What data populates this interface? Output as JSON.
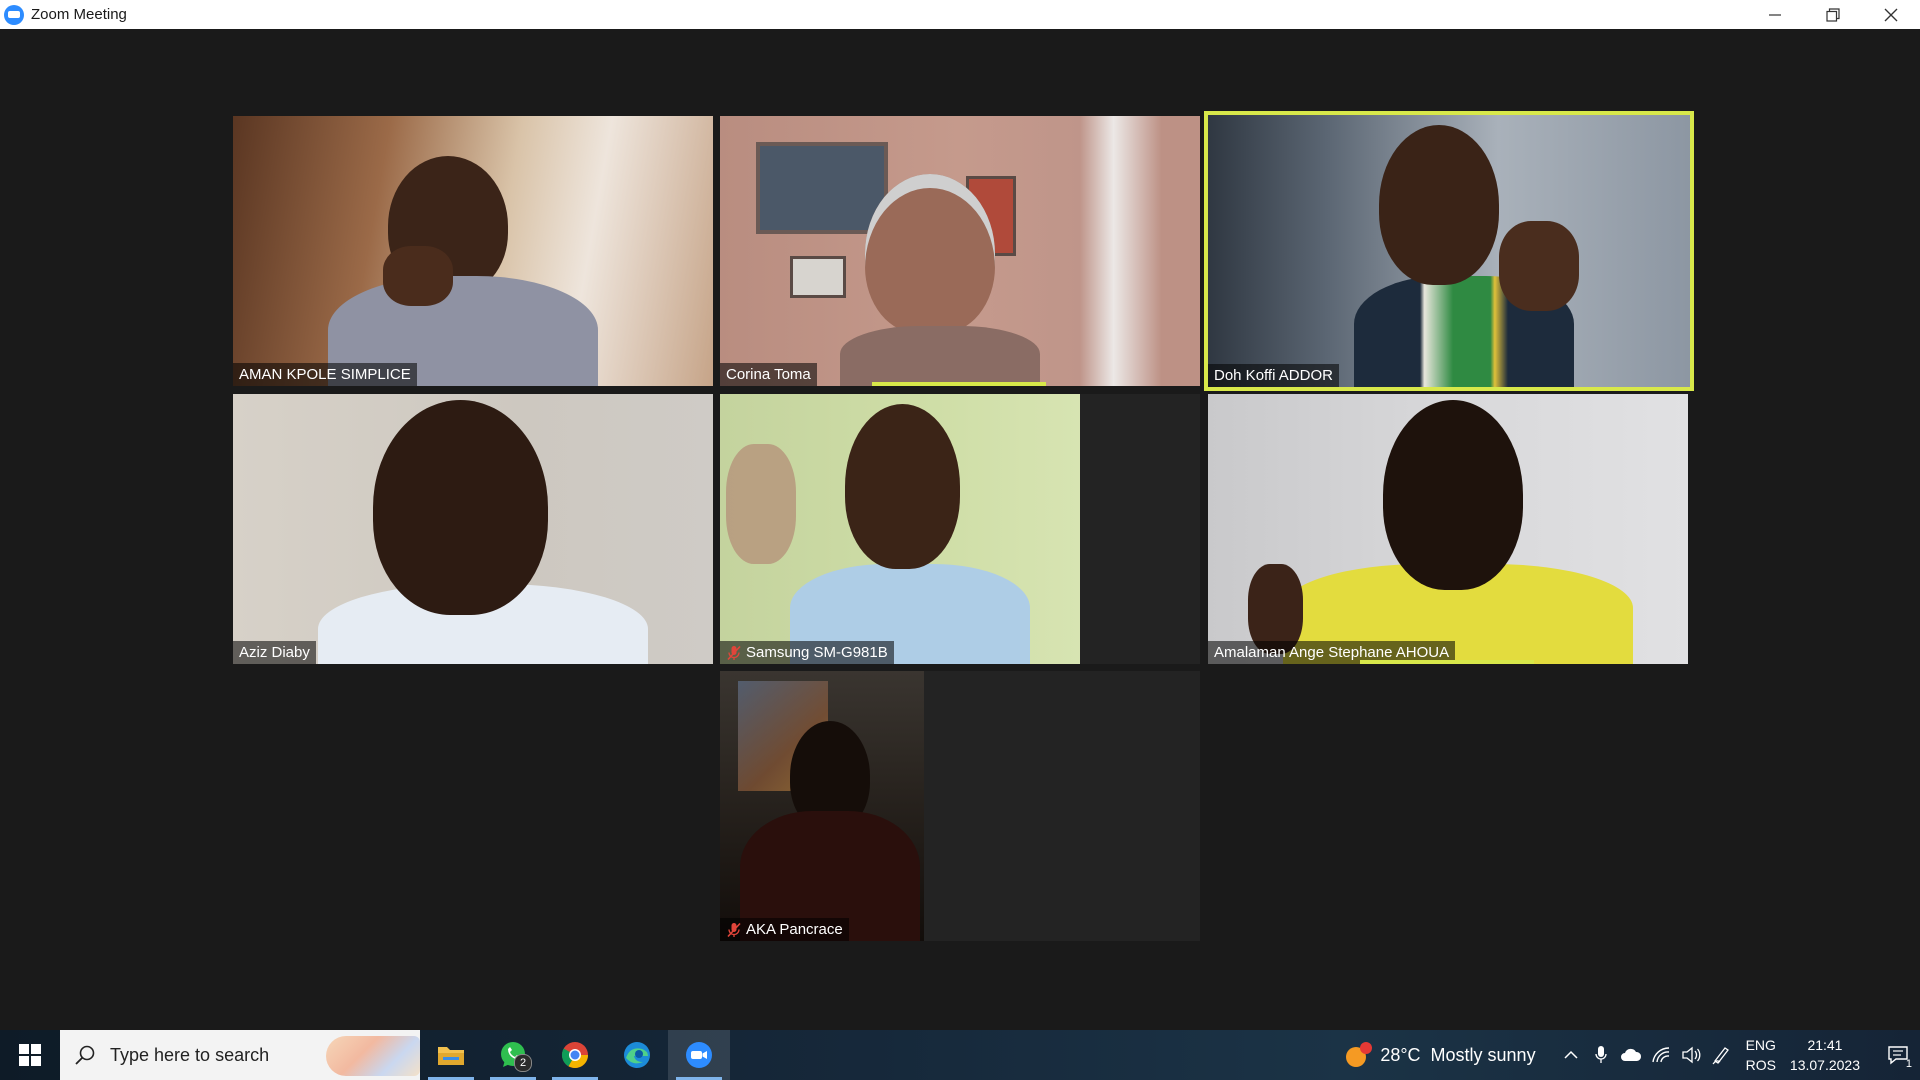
{
  "window": {
    "title": "Zoom Meeting",
    "controls": [
      "minimize",
      "restore",
      "close"
    ]
  },
  "participants": [
    {
      "name": "AMAN KPOLE SIMPLICE",
      "muted": false,
      "active_speaker": false
    },
    {
      "name": "Corina Toma",
      "muted": false,
      "active_speaker": false
    },
    {
      "name": "Doh Koffi ADDOR",
      "muted": false,
      "active_speaker": true
    },
    {
      "name": "Aziz Diaby",
      "muted": false,
      "active_speaker": false
    },
    {
      "name": "Samsung SM-G981B",
      "muted": true,
      "active_speaker": false
    },
    {
      "name": "Amalaman Ange Stephane AHOUA",
      "muted": false,
      "active_speaker": false
    },
    {
      "name": "AKA Pancrace",
      "muted": true,
      "active_speaker": false
    }
  ],
  "taskbar": {
    "search_placeholder": "Type here to search",
    "apps": [
      {
        "name": "file-explorer-icon"
      },
      {
        "name": "whatsapp-icon",
        "badge": "2"
      },
      {
        "name": "chrome-icon"
      },
      {
        "name": "edge-icon"
      },
      {
        "name": "zoom-icon",
        "label": "zoom",
        "active": true
      }
    ],
    "weather": {
      "temp": "28°C",
      "condition": "Mostly sunny",
      "alert": "1"
    },
    "language": {
      "line1": "ENG",
      "line2": "ROS"
    },
    "clock": {
      "time": "21:41",
      "date": "13.07.2023"
    },
    "notifications": "1"
  },
  "colors": {
    "background": "#1a1a1a",
    "active_speaker": "#d8e84a",
    "mute": "#e0453a",
    "zoom_blue": "#2d8cff"
  }
}
